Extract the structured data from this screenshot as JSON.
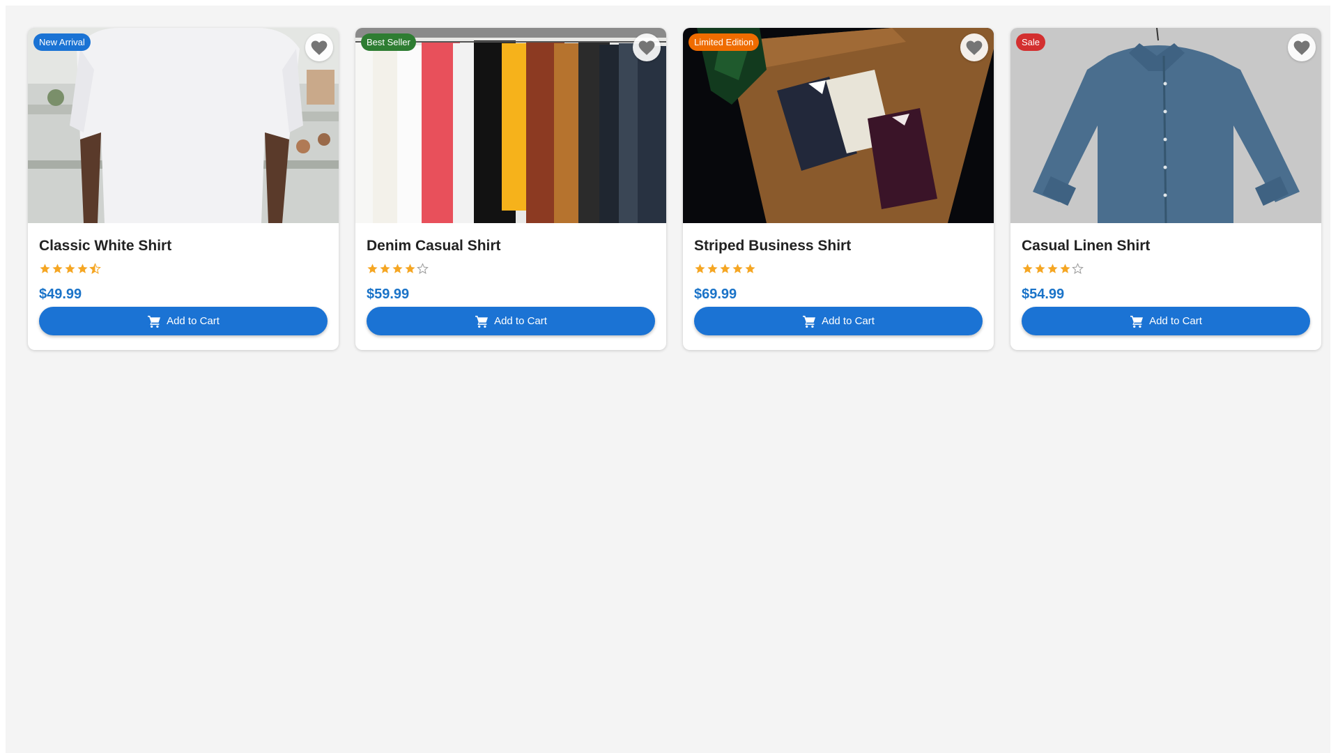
{
  "products": [
    {
      "name": "Classic White Shirt",
      "badge": "New Arrival",
      "badge_color": "#1a73d4",
      "rating": 4.5,
      "price": "$49.99",
      "button_label": "Add to Cart",
      "icon": "heart-icon"
    },
    {
      "name": "Denim Casual Shirt",
      "badge": "Best Seller",
      "badge_color": "#2e7d32",
      "rating": 4,
      "price": "$59.99",
      "button_label": "Add to Cart",
      "icon": "heart-icon"
    },
    {
      "name": "Striped Business Shirt",
      "badge": "Limited Edition",
      "badge_color": "#ef6c00",
      "rating": 5,
      "price": "$69.99",
      "button_label": "Add to Cart",
      "icon": "heart-icon"
    },
    {
      "name": "Casual Linen Shirt",
      "badge": "Sale",
      "badge_color": "#d32f2f",
      "rating": 4,
      "price": "$54.99",
      "button_label": "Add to Cart",
      "icon": "heart-icon"
    }
  ],
  "colors": {
    "page_background": "#f4f4f4",
    "price": "#1a73c8",
    "button": "#1b73d4",
    "star": "#f5a623"
  }
}
